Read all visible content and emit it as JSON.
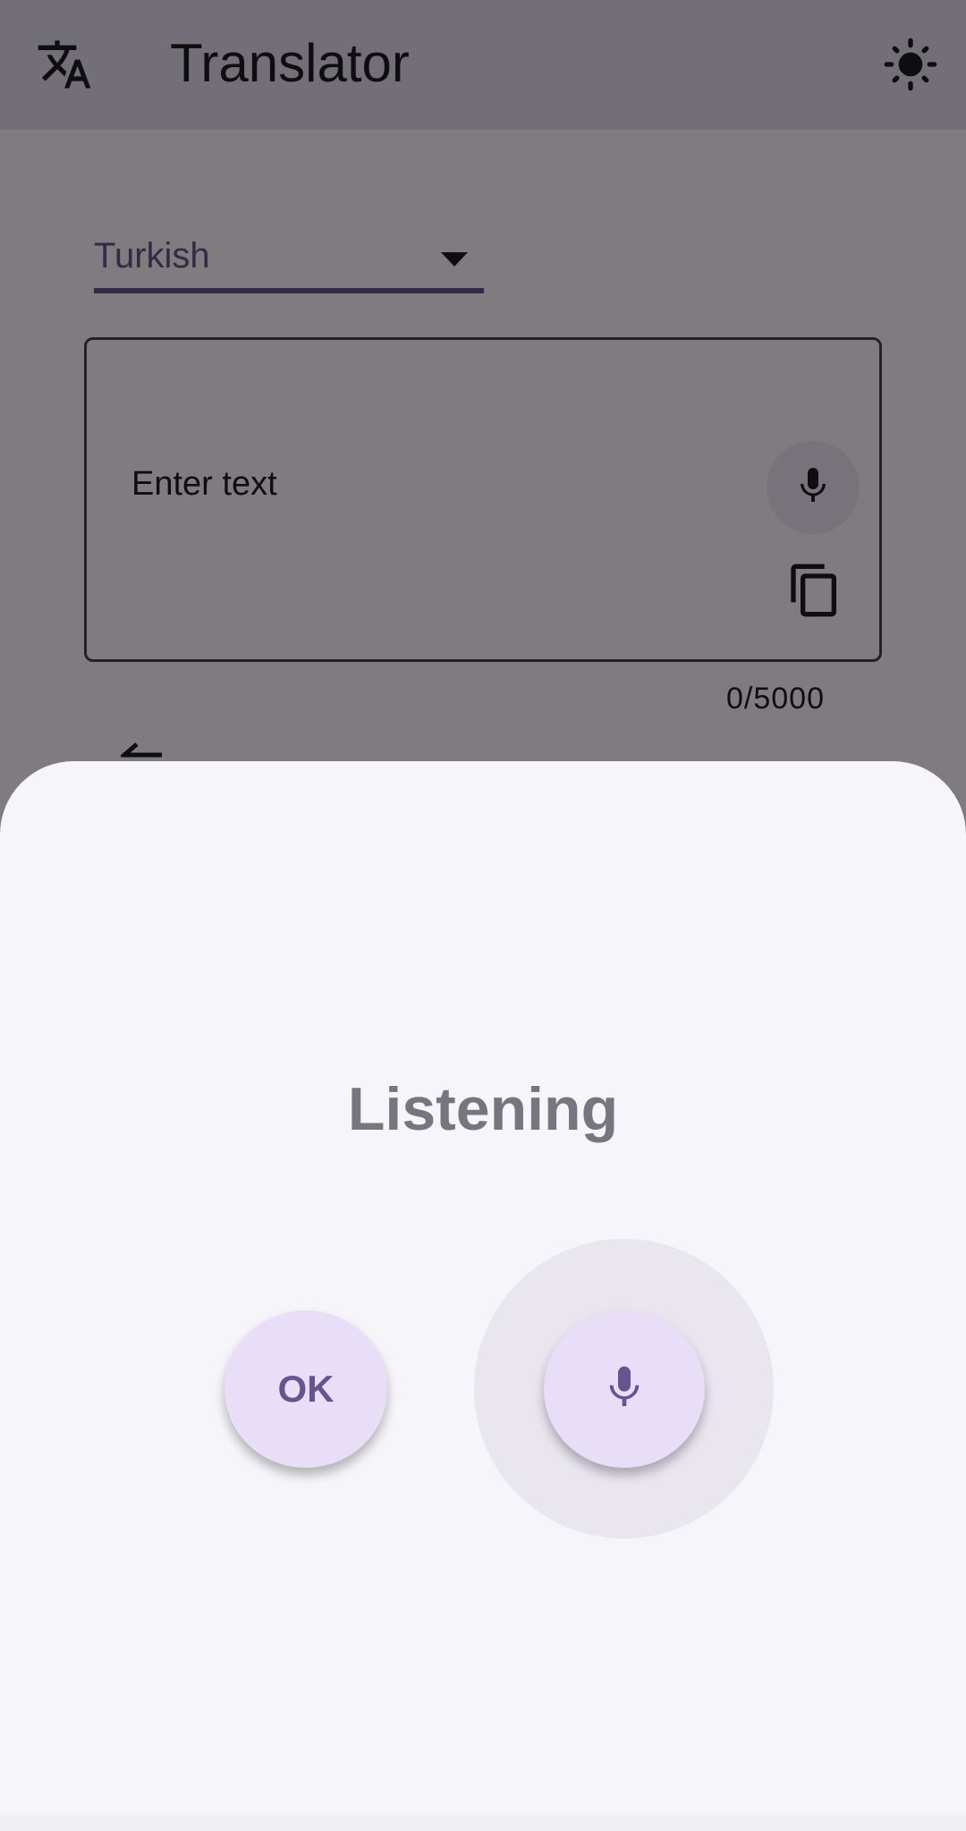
{
  "app_bar": {
    "title": "Translator",
    "left_icon": "translate-icon",
    "right_icon": "sun-icon"
  },
  "language_dropdown": {
    "value": "Turkish",
    "icon": "caret-down-icon"
  },
  "input": {
    "placeholder": "Enter text",
    "mic_icon": "microphone-icon",
    "copy_icon": "copy-icon"
  },
  "counter": "0/5000",
  "speech_sheet": {
    "status": "Listening",
    "ok_label": "OK",
    "mic_icon": "microphone-icon"
  },
  "colors": {
    "primary": "#65558f",
    "surface": "#fef7ff",
    "sheet": "#f6f5fa",
    "fab": "#e8def8"
  }
}
